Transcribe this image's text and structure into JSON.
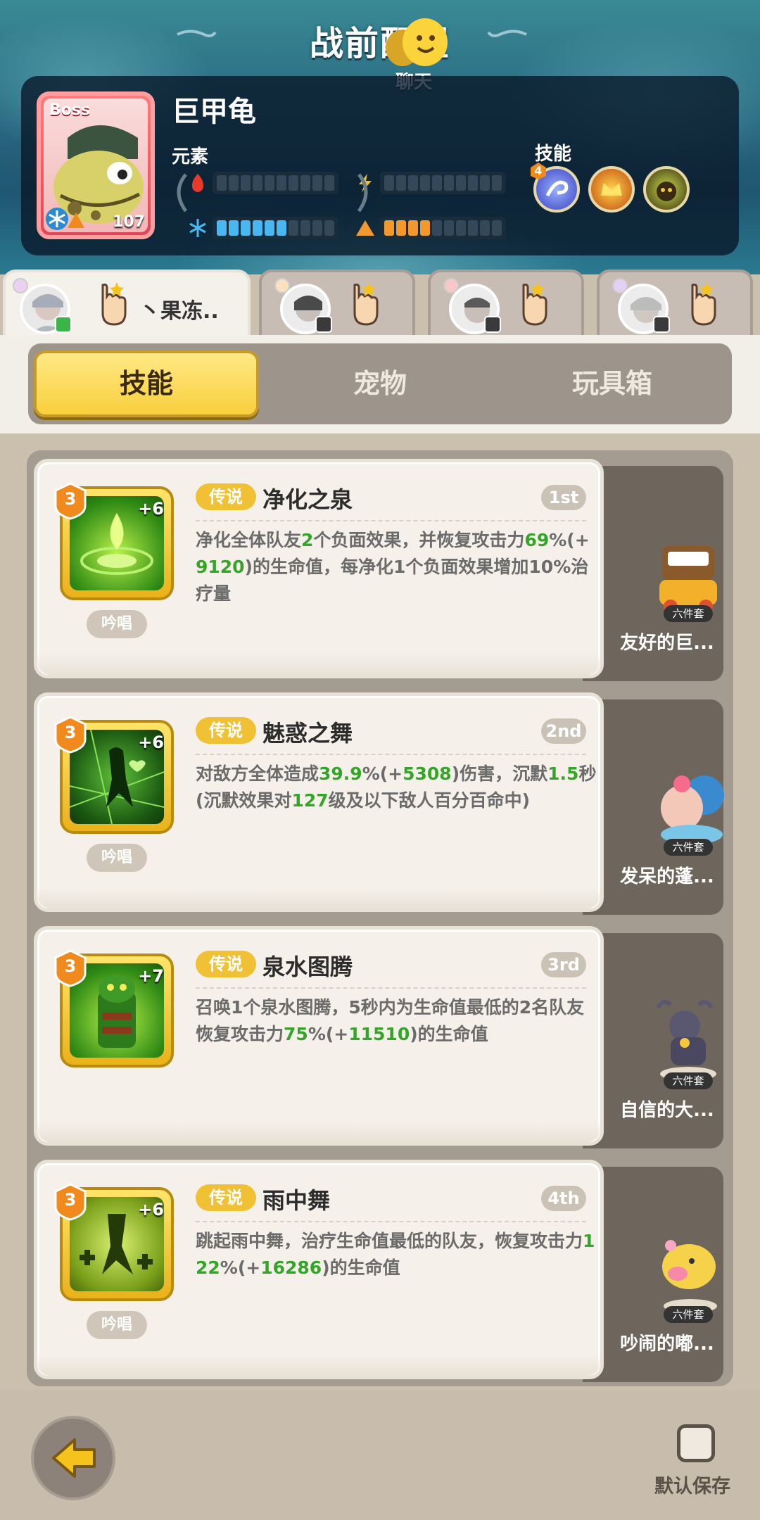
{
  "header": {
    "title": "战前配置",
    "chat_label": "聊天"
  },
  "boss": {
    "tag": "Boss",
    "name": "巨甲龟",
    "level": "107",
    "element_label": "元素",
    "skill_label": "技能",
    "skill_badge": "4",
    "element_bars": {
      "fire": {
        "filled": 0,
        "total": 10
      },
      "lightning": {
        "filled": 0,
        "total": 10
      },
      "ice": {
        "filled": 6,
        "total": 10
      },
      "earth": {
        "filled": 4,
        "total": 10
      }
    }
  },
  "players": [
    {
      "name": "丶果冻.."
    },
    {
      "name": ""
    },
    {
      "name": ""
    },
    {
      "name": ""
    }
  ],
  "categories": {
    "skills": "技能",
    "pets": "宠物",
    "toybox": "玩具箱"
  },
  "skills": [
    {
      "level": "3",
      "plus": "+6",
      "chant": "吟唱",
      "rarity": "传说",
      "name": "净化之泉",
      "order": "1st",
      "desc_parts": [
        "净化全体队友",
        "2",
        "个负面效果，并恢复攻击力",
        "69",
        "%(+",
        "9120",
        ")的生命值，每净化1个负面效果增加10%治疗量"
      ],
      "pet": "友好的巨..."
    },
    {
      "level": "3",
      "plus": "+6",
      "chant": "吟唱",
      "rarity": "传说",
      "name": "魅惑之舞",
      "order": "2nd",
      "desc_parts": [
        "对敌方全体造成",
        "39.9",
        "%(+",
        "5308",
        ")伤害，沉默",
        "1.5",
        "秒(沉默效果对",
        "127",
        "级及以下敌人百分百命中)"
      ],
      "pet": "发呆的蓬..."
    },
    {
      "level": "3",
      "plus": "+7",
      "chant": "",
      "rarity": "传说",
      "name": "泉水图腾",
      "order": "3rd",
      "desc_parts": [
        "召唤1个泉水图腾，5秒内为生命值最低的2名队友恢复攻击力",
        "75",
        "%(+",
        "11510",
        ")的生命值"
      ],
      "pet": "自信的大..."
    },
    {
      "level": "3",
      "plus": "+6",
      "chant": "吟唱",
      "rarity": "传说",
      "name": "雨中舞",
      "order": "4th",
      "desc_parts": [
        "跳起雨中舞，治疗生命值最低的队友，恢复攻击力",
        "122",
        "%(+",
        "16286",
        ")的生命值"
      ],
      "pet": "吵闹的嘟..."
    }
  ],
  "pet_set_badge": "六件套",
  "footer": {
    "save_label": "默认保存"
  }
}
